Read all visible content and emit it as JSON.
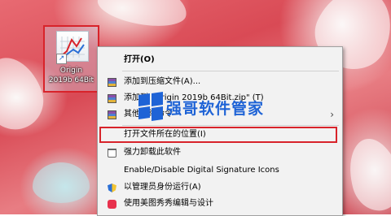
{
  "desktop": {
    "icon_label": "Origin\n2019b 64Bit"
  },
  "context_menu": {
    "items": [
      {
        "label": "打开(O)",
        "bold": true
      },
      {
        "label": "添加到压缩文件(A)..."
      },
      {
        "label": "添加到 \"Origin 2019b 64Bit.zip\" (T)"
      },
      {
        "label": "其他压缩命令"
      },
      {
        "label": "打开文件所在的位置(I)"
      },
      {
        "label": "强力卸载此软件"
      },
      {
        "label": "Enable/Disable Digital Signature Icons"
      },
      {
        "label": "以管理员身份运行(A)"
      },
      {
        "label": "使用美图秀秀编辑与设计"
      }
    ],
    "submenu_arrow": "›"
  },
  "watermark": {
    "text": "强哥软件管家"
  },
  "colors": {
    "highlight_border": "#d8232a",
    "watermark_blue": "#1e63d6"
  }
}
